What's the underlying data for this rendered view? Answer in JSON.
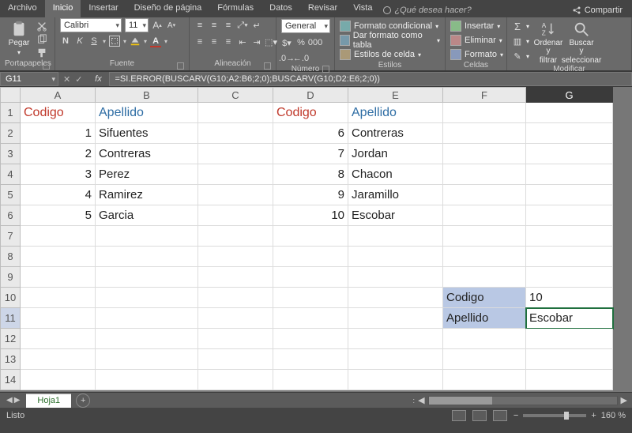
{
  "menu": {
    "tabs": [
      "Archivo",
      "Inicio",
      "Insertar",
      "Diseño de página",
      "Fórmulas",
      "Datos",
      "Revisar",
      "Vista"
    ],
    "active_index": 1,
    "help_placeholder": "¿Qué desea hacer?",
    "share": "Compartir"
  },
  "ribbon": {
    "clipboard": {
      "paste": "Pegar",
      "label": "Portapapeles"
    },
    "font": {
      "name": "Calibri",
      "size": "11",
      "bold": "N",
      "italic": "K",
      "underline": "S",
      "label": "Fuente"
    },
    "alignment": {
      "label": "Alineación"
    },
    "number": {
      "format": "General",
      "label": "Número"
    },
    "styles": {
      "conditional": "Formato condicional",
      "as_table": "Dar formato como tabla",
      "cell_styles": "Estilos de celda",
      "label": "Estilos"
    },
    "cells": {
      "insert": "Insertar",
      "delete": "Eliminar",
      "format": "Formato",
      "label": "Celdas"
    },
    "editing": {
      "sort": "Ordenar y",
      "sort2": "filtrar",
      "find": "Buscar y",
      "find2": "seleccionar",
      "label": "Modificar"
    }
  },
  "formula_bar": {
    "cell_ref": "G11",
    "formula": "=SI.ERROR(BUSCARV(G10;A2:B6;2;0);BUSCARV(G10;D2:E6;2;0))"
  },
  "grid": {
    "columns": [
      "A",
      "B",
      "C",
      "D",
      "E",
      "F",
      "G"
    ],
    "active_col_index": 6,
    "row_count": 14,
    "active_row": 11,
    "headers": {
      "codigo": "Codigo",
      "apellido": "Apellido"
    },
    "table1": [
      {
        "codigo": "1",
        "apellido": "Sifuentes"
      },
      {
        "codigo": "2",
        "apellido": "Contreras"
      },
      {
        "codigo": "3",
        "apellido": "Perez"
      },
      {
        "codigo": "4",
        "apellido": "Ramirez"
      },
      {
        "codigo": "5",
        "apellido": "Garcia"
      }
    ],
    "table2": [
      {
        "codigo": "6",
        "apellido": "Contreras"
      },
      {
        "codigo": "7",
        "apellido": "Jordan"
      },
      {
        "codigo": "8",
        "apellido": "Chacon"
      },
      {
        "codigo": "9",
        "apellido": "Jaramillo"
      },
      {
        "codigo": "10",
        "apellido": "Escobar"
      }
    ],
    "lookup": {
      "label_codigo": "Codigo",
      "label_apellido": "Apellido",
      "value_codigo": "10",
      "value_apellido": "Escobar"
    }
  },
  "sheet_tabs": {
    "active": "Hoja1"
  },
  "status": {
    "ready": "Listo",
    "zoom": "160 %"
  }
}
